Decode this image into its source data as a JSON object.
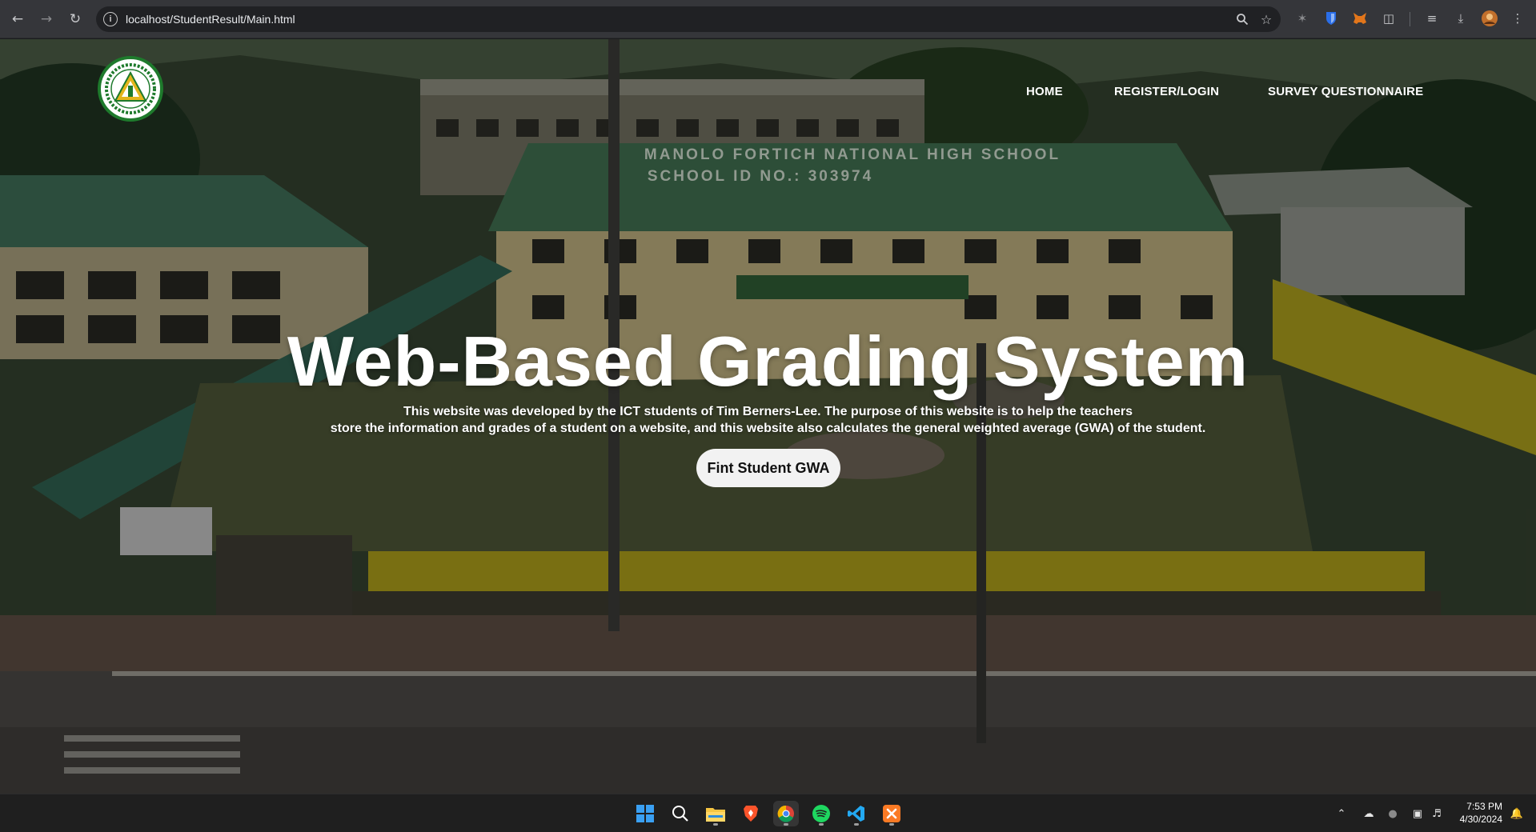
{
  "browser": {
    "url": "localhost/StudentResult/Main.html"
  },
  "nav": {
    "home": "HOME",
    "register_login": "REGISTER/LOGIN",
    "survey": "SURVEY QUESTIONNAIRE"
  },
  "hero": {
    "title": "Web-Based Grading System",
    "description_line1": "This website was developed by the ICT students of Tim Berners-Lee. The purpose of this website is to help the teachers",
    "description_line2": "store the information and grades of a student on a website, and this website also calculates the general weighted average (GWA) of the student.",
    "button_label": "Fint Student GWA"
  },
  "taskbar": {
    "time": "7:53 PM",
    "date": "4/30/2024"
  },
  "colors": {
    "accent_green": "#1e7a2c",
    "school_yellow": "#e3cf2a",
    "button_bg": "#f2f2f2"
  }
}
